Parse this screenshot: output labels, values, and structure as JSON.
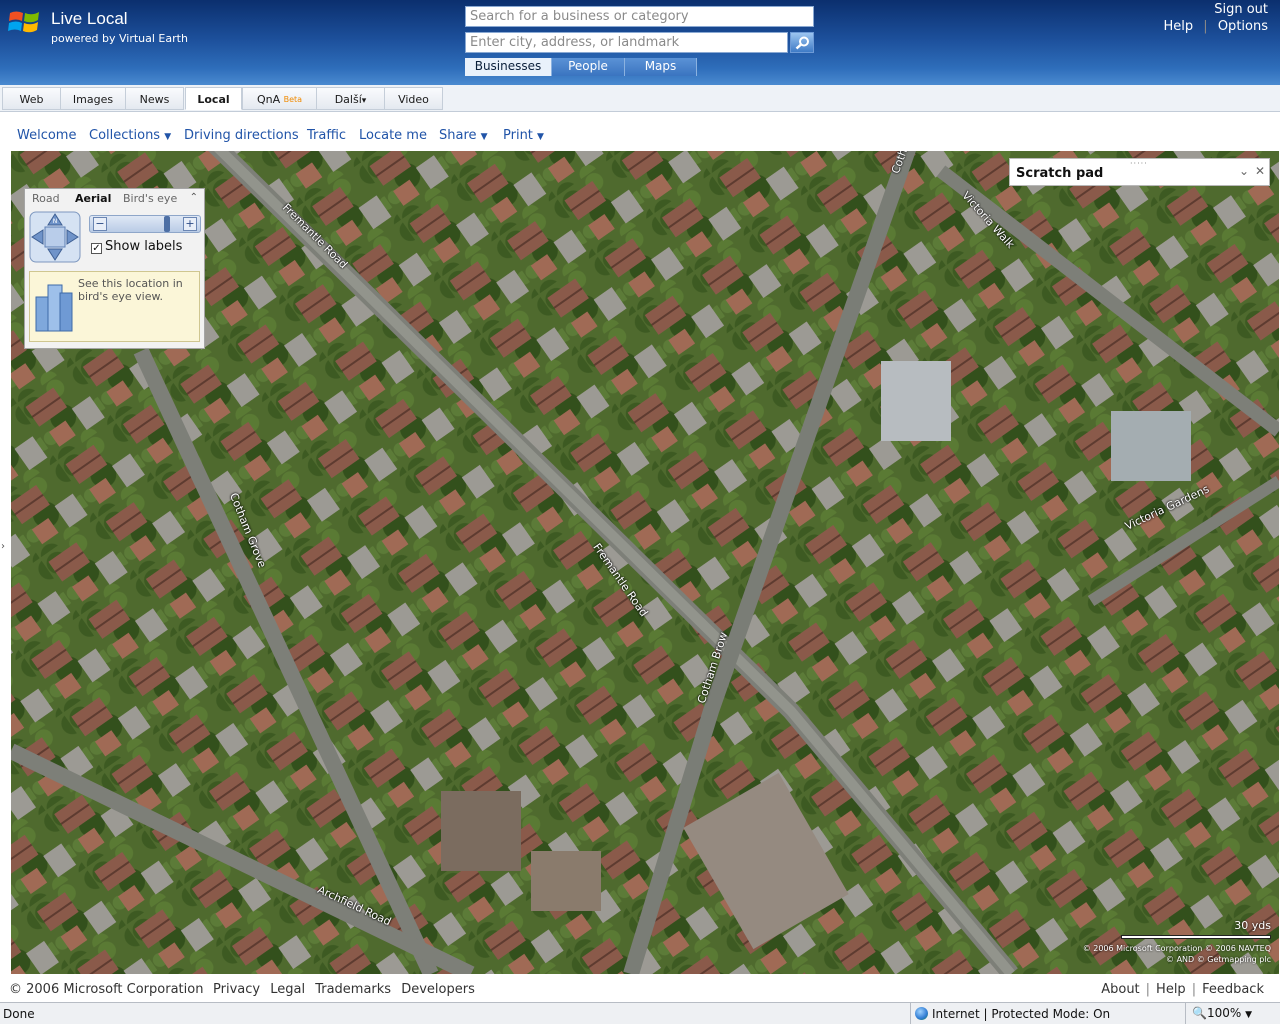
{
  "header": {
    "brand": "Live Local",
    "brand_sub": "powered by Virtual Earth",
    "what_placeholder": "Search for a business or category",
    "where_placeholder": "Enter city, address, or landmark",
    "scope_tabs": [
      "Businesses",
      "People",
      "Maps"
    ],
    "sign_out": "Sign out",
    "help": "Help",
    "options": "Options",
    "separator": "|"
  },
  "nav": {
    "tabs": [
      "Web",
      "Images",
      "News",
      "Local",
      "QnA",
      "Další",
      "Video"
    ],
    "beta": "Beta"
  },
  "commands": {
    "welcome": "Welcome",
    "collections": "Collections",
    "driving": "Driving directions",
    "traffic": "Traffic",
    "locate": "Locate me",
    "share": "Share",
    "print": "Print"
  },
  "map_control": {
    "tabs": [
      "Road",
      "Aerial",
      "Bird's eye"
    ],
    "show_labels": "Show labels",
    "birds_eye_hint": "See this location in bird's eye view."
  },
  "scratch_pad": {
    "title": "Scratch pad"
  },
  "streets": {
    "fremantle_top": "Fremantle Road",
    "fremantle_mid": "Fremantle Road",
    "cotham_grove": "Cotham Grove",
    "cotham_brow": "Cotham Brow",
    "victoria_walk": "Victoria Walk",
    "victoria_gardens": "Victoria Gardens",
    "archfield": "Archfield Road",
    "cotham_top": "Coth"
  },
  "scale": "30 yds",
  "copyright_lines": [
    "© 2006 Microsoft Corporation  © 2006 NAVTEQ",
    "© AND  © Getmapping plc"
  ],
  "footer": {
    "copyright": "© 2006 Microsoft Corporation",
    "links": [
      "Privacy",
      "Legal",
      "Trademarks",
      "Developers"
    ],
    "about": "About",
    "help": "Help",
    "feedback": "Feedback"
  },
  "status": {
    "left": "Done",
    "zone": "Internet | Protected Mode: On",
    "zoom": "100%"
  },
  "colors": {
    "header_blue": "#1c4f9a",
    "link_blue": "#2154a8",
    "map_green": "#5b6c3a"
  }
}
